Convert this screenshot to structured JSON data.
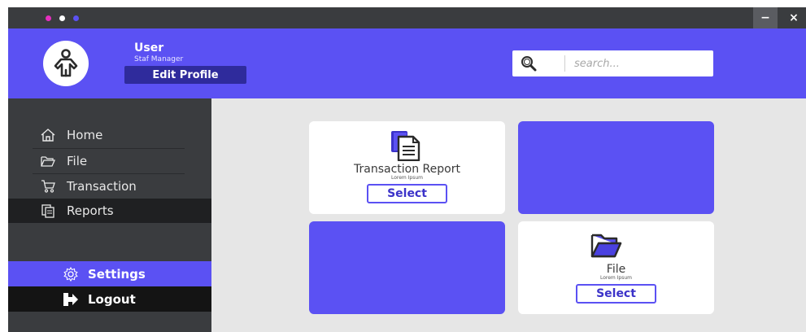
{
  "window": {
    "dots": [
      "#e62fbf",
      "#ffffff",
      "#5b51f3"
    ],
    "minimize_symbol": "−",
    "close_symbol": "×"
  },
  "header": {
    "user_name": "User",
    "user_role": "Staf Manager",
    "edit_profile_label": "Edit Profile",
    "search_placeholder": "search...",
    "avatar_icon": "user-icon",
    "search_icon": "magnifier-icon"
  },
  "sidebar": {
    "items": [
      {
        "label": "Home",
        "icon": "home-icon"
      },
      {
        "label": "File",
        "icon": "folder-icon"
      },
      {
        "label": "Transaction",
        "icon": "cart-icon"
      },
      {
        "label": "Reports",
        "icon": "reports-icon",
        "active": true
      }
    ],
    "settings_label": "Settings",
    "logout_label": "Logout"
  },
  "cards": [
    {
      "title": "Transaction Report",
      "subtitle": "Lorem Ipsum",
      "button": "Select",
      "icon": "documents-icon"
    },
    {
      "title": "File",
      "subtitle": "Lorem Ipsum",
      "button": "Select",
      "icon": "open-folder-icon"
    }
  ],
  "colors": {
    "accent": "#5b51f3",
    "dark": "#3a3c3f",
    "edit_profile_bg": "#2f2b9c",
    "content_bg": "#e6e6e6"
  }
}
